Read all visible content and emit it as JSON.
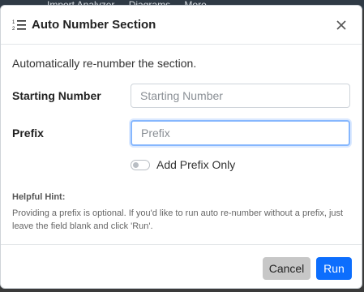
{
  "background": {
    "menu_items": [
      "Import Analyzer",
      "Diagrams",
      "More"
    ]
  },
  "dialog": {
    "title": "Auto Number Section",
    "description": "Automatically re-number the section.",
    "fields": {
      "starting_number": {
        "label": "Starting Number",
        "placeholder": "Starting Number",
        "value": ""
      },
      "prefix": {
        "label": "Prefix",
        "placeholder": "Prefix",
        "value": ""
      }
    },
    "toggle": {
      "label": "Add Prefix Only",
      "checked": false
    },
    "hint": {
      "title": "Helpful Hint:",
      "text": "Providing a prefix is optional. If you'd like to run auto re-number without a prefix, just leave the field blank and click 'Run'."
    },
    "buttons": {
      "cancel": "Cancel",
      "run": "Run"
    }
  },
  "colors": {
    "primary": "#0d6efd",
    "cancel_bg": "#c7c7c7",
    "focus_border": "#86b7fe"
  }
}
